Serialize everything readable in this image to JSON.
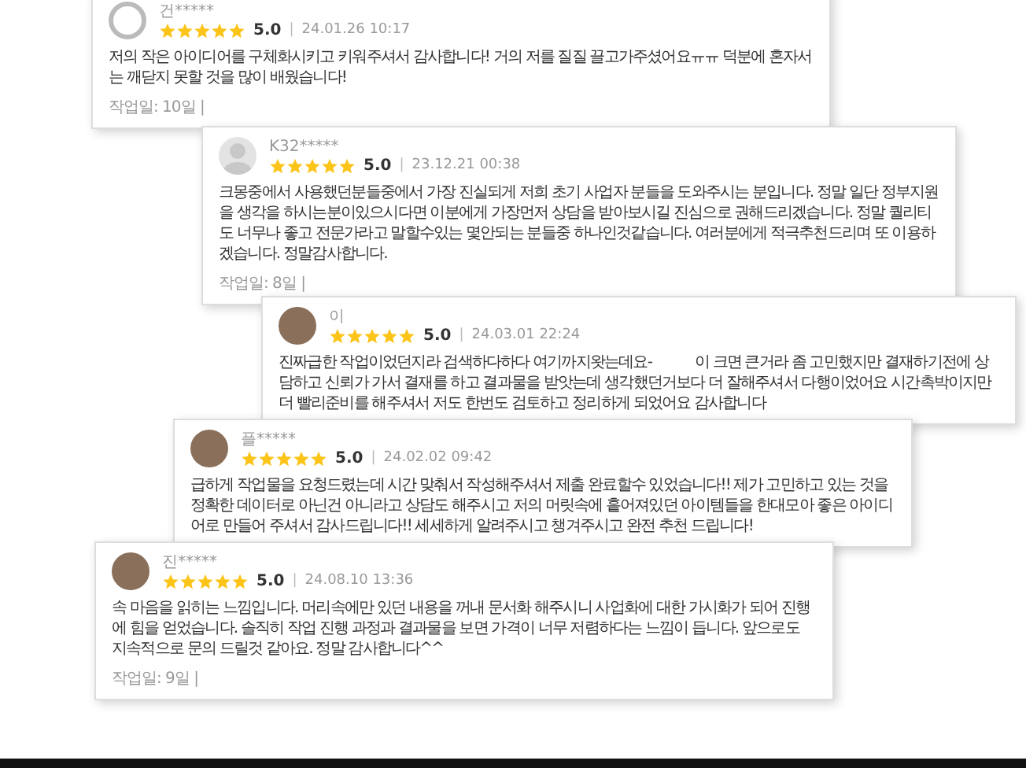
{
  "reviews": [
    {
      "avatar": {
        "kind": "outline"
      },
      "name": "건*****",
      "stars": 5,
      "rating": "5.0",
      "separator": "|",
      "date": "24.01.26 10:17",
      "text": "저의 작은 아이디어를 구체화시키고 키워주셔서 감사합니다! 거의 저를 질질 끌고가주셨어요ㅠㅠ 덕분에 혼자서는 깨닫지 못할 것을 많이 배웠습니다!",
      "footer": "작업일: 10일 |"
    },
    {
      "avatar": {
        "kind": "silhouette"
      },
      "name": "K32*****",
      "stars": 5,
      "rating": "5.0",
      "separator": "|",
      "date": "23.12.21 00:38",
      "text": "크몽중에서 사용했던분들중에서 가장 진실되게 저희 초기 사업자 분들을 도와주시는 분입니다. 정말 일단 정부지원을 생각을 하시는분이있으시다면 이분에게 가장먼저 상담을 받아보시길 진심으로 권해드리겠습니다. 정말 퀄리티도 너무나 좋고 전문가라고 말할수있는 몇안되는 분들중 하나인것같습니다. 여러분에게 적극추천드리며 또 이용하겠습니다. 정말감사합니다.",
      "footer": "작업일: 8일 |"
    },
    {
      "avatar": {
        "kind": "photo"
      },
      "name": "이",
      "stars": 5,
      "rating": "5.0",
      "separator": "|",
      "date": "24.03.01 22:24",
      "text": "진짜급한 작업이었던지라 검색하다하다 여기까지왓는데요-            이 크면 큰거라 좀 고민했지만 결재하기전에 상담하고 신뢰가 가서 결재를 하고 결과물을 받앗는데 생각했던거보다 더 잘해주셔서 다행이었어요 시간촉박이지만 더 빨리준비를 해주셔서 저도 한번도 검토하고 정리하게 되었어요 감사합니다"
    },
    {
      "avatar": {
        "kind": "photo"
      },
      "name": "플*****",
      "stars": 5,
      "rating": "5.0",
      "separator": "|",
      "date": "24.02.02 09:42",
      "text": "급하게 작업물을 요청드렸는데 시간 맞춰서 작성해주셔서 제출 완료할수 있었습니다!! 제가 고민하고 있는 것을 정확한 데이터로 아닌건 아니라고 상담도 해주시고 저의 머릿속에 흩어져있던 아이템들을 한대모아 좋은 아이디어로 만들어 주셔서 감사드립니다!! 세세하게 알려주시고 챙겨주시고 완전 추천 드립니다!"
    },
    {
      "avatar": {
        "kind": "photo"
      },
      "name": "진*****",
      "stars": 5,
      "rating": "5.0",
      "separator": "|",
      "date": "24.08.10 13:36",
      "text": "속 마음을 읽히는 느낌입니다. 머리속에만 있던 내용을 꺼내 문서화 해주시니 사업화에 대한 가시화가 되어 진행에 힘을 얻었습니다. 솔직히 작업 진행 과정과 결과물을 보면 가격이 너무 저렴하다는 느낌이 듭니다. 앞으로도 지속적으로 문의 드릴것 같아요. 정말 감사합니다^^",
      "footer": "작업일: 9일 |"
    }
  ]
}
